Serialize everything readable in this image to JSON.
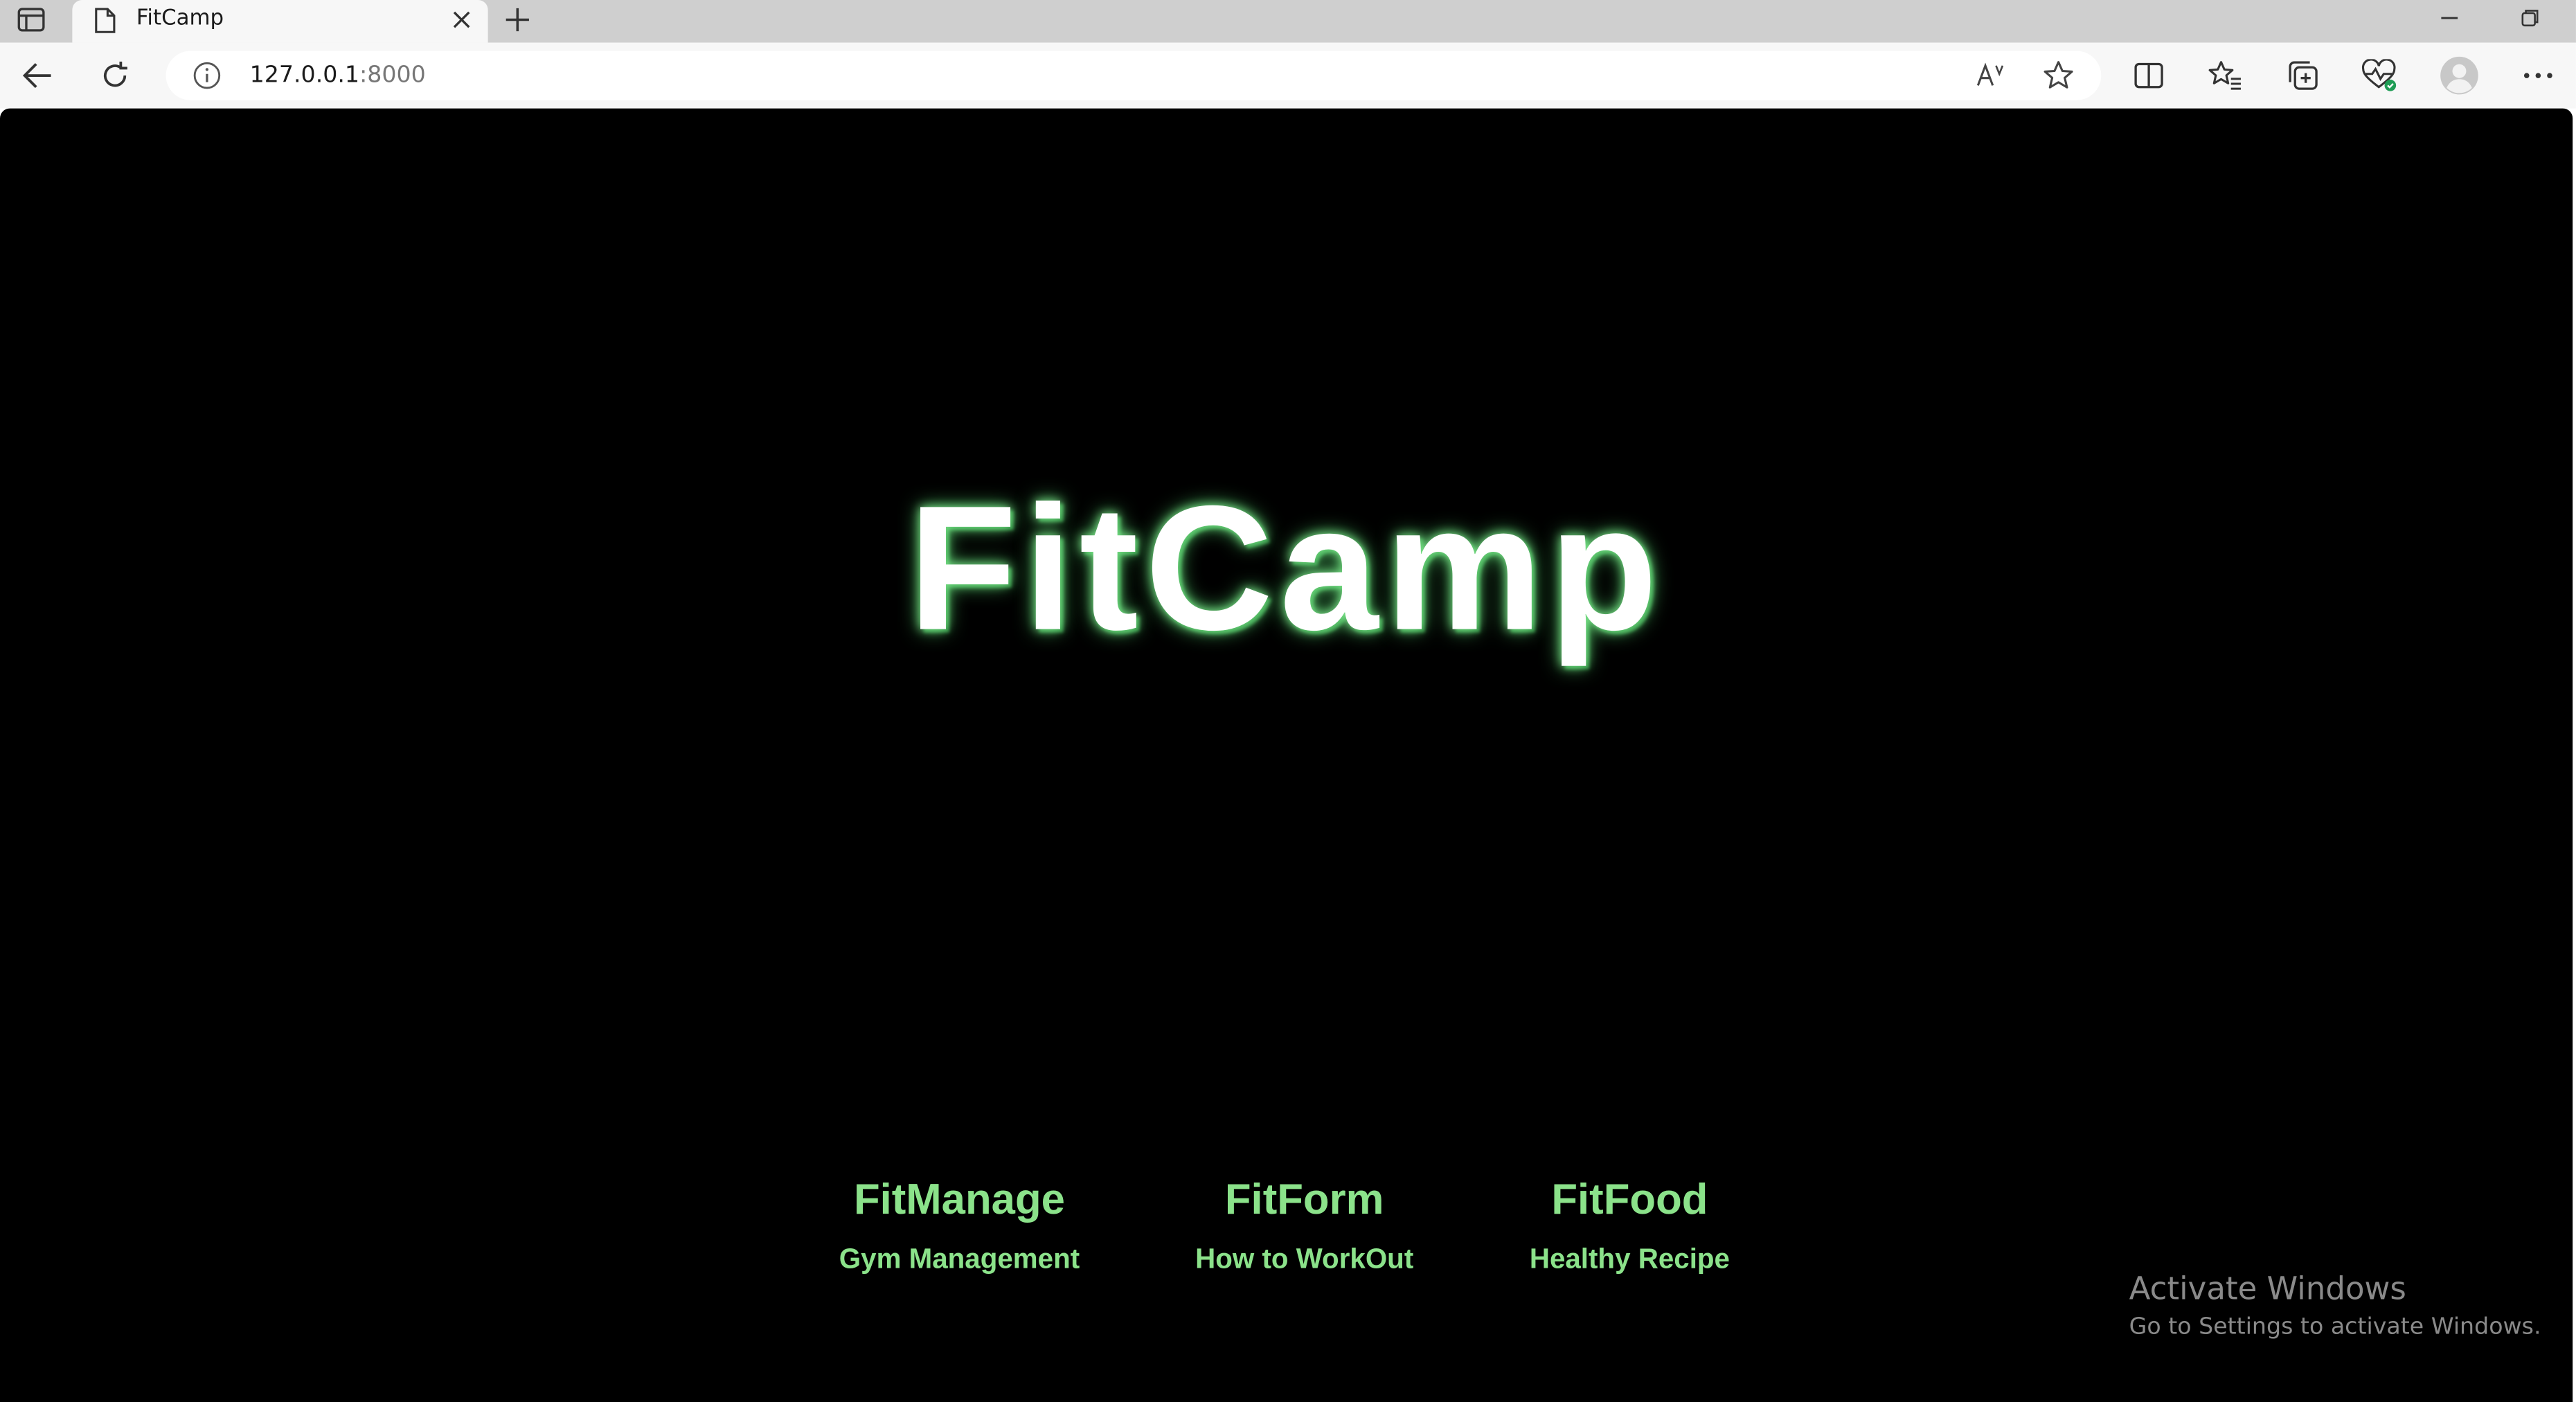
{
  "browser": {
    "tab": {
      "title": "FitCamp",
      "favicon": "page-icon"
    },
    "address_bar": {
      "url_host": "127.0.0.1",
      "url_port": ":8000"
    },
    "icons": {
      "tab_actions": "tab-actions-icon",
      "close_tab": "close-icon",
      "new_tab": "plus-icon",
      "minimize": "minimize-icon",
      "restore": "restore-icon",
      "back": "back-arrow-icon",
      "refresh": "refresh-icon",
      "site_info": "info-icon",
      "read_aloud": "read-aloud-icon",
      "favorite": "star-icon",
      "split_screen": "split-screen-icon",
      "favorites": "favorites-icon",
      "collections": "collections-icon",
      "browser_essentials": "heart-pulse-icon",
      "profile": "profile-icon",
      "menu": "more-icon"
    }
  },
  "page": {
    "title": "FitCamp",
    "title_glow_color": "#7ee28a",
    "link_color": "#8be28a",
    "background_color": "#000000",
    "links": [
      {
        "title": "FitManage",
        "subtitle": "Gym Management"
      },
      {
        "title": "FitForm",
        "subtitle": "How to WorkOut"
      },
      {
        "title": "FitFood",
        "subtitle": "Healthy Recipe"
      }
    ]
  },
  "watermark": {
    "title": "Activate Windows",
    "subtitle": "Go to Settings to activate Windows."
  }
}
